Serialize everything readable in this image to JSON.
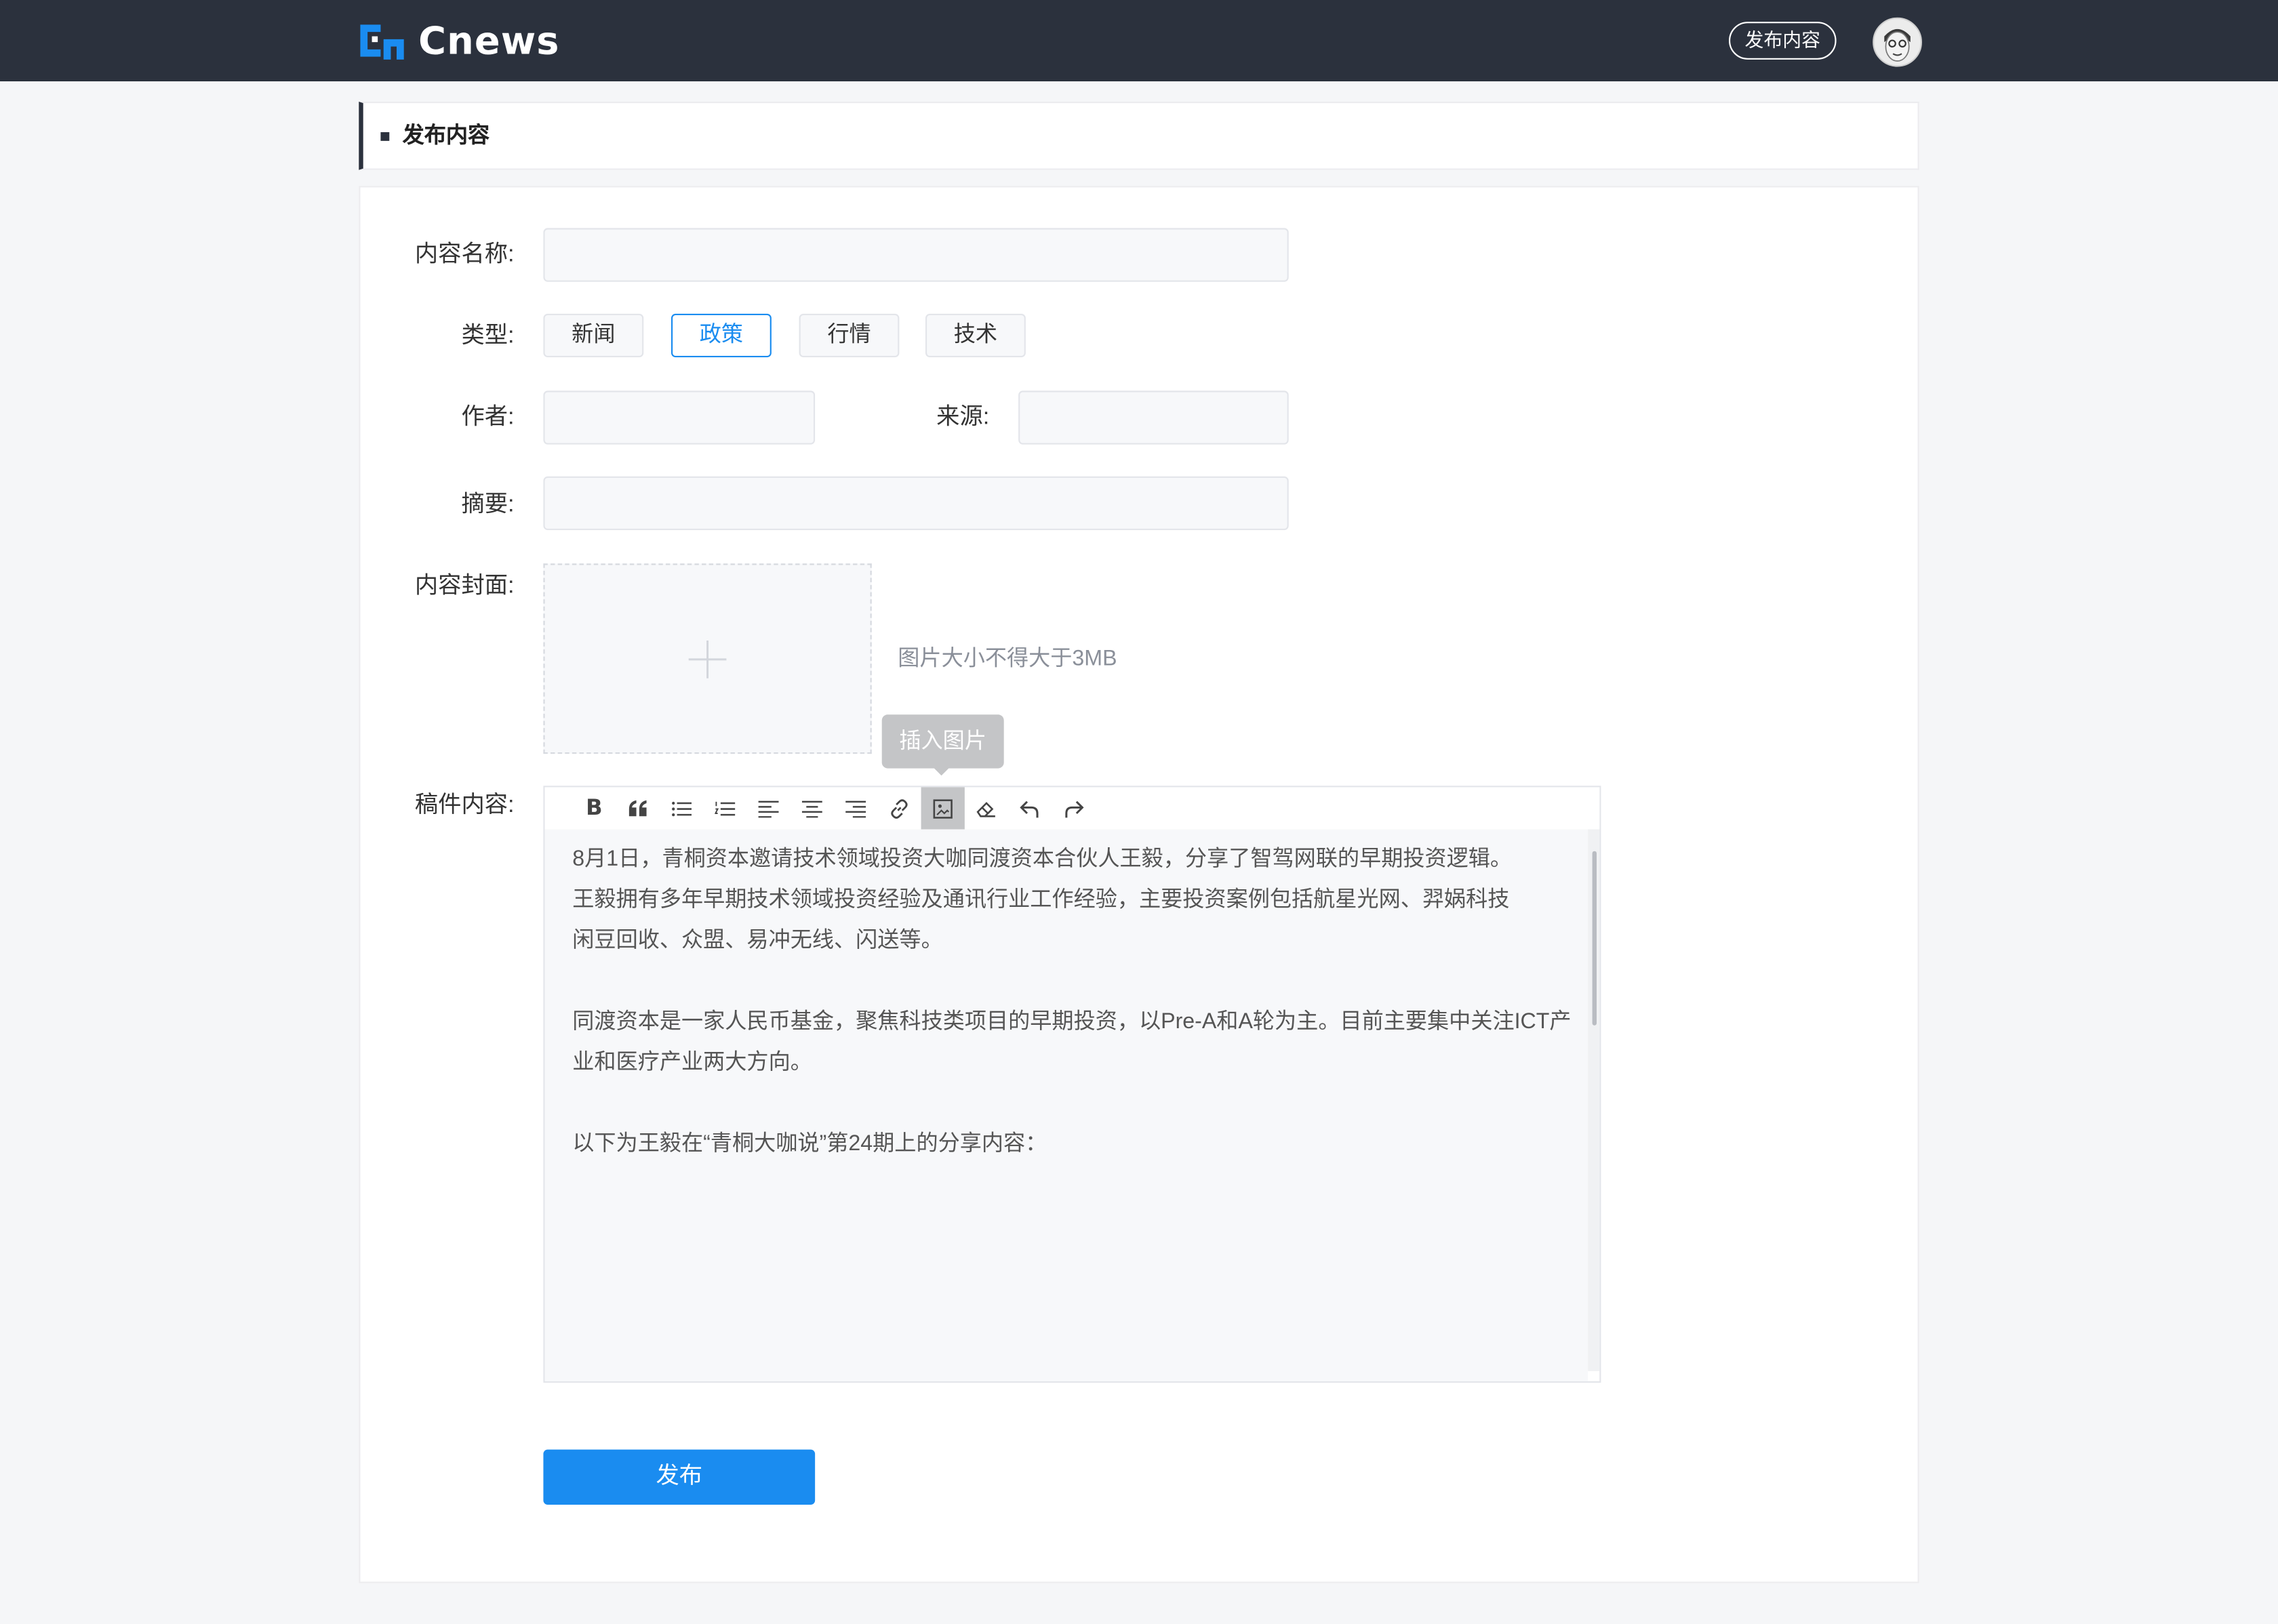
{
  "header": {
    "logo_text": "Cnews",
    "publish_link": "发布内容",
    "avatar_alt": ""
  },
  "page_title": "发布内容",
  "form": {
    "title_label": "内容名称:",
    "title_value": "",
    "type_label": "类型:",
    "types": [
      "新闻",
      "政策",
      "行情",
      "技术"
    ],
    "selected_type": "政策",
    "author_label": "作者:",
    "author_value": "",
    "source_label": "来源:",
    "source_value": "",
    "summary_label": "摘要:",
    "summary_value": "",
    "cover_label": "内容封面:",
    "cover_hint": "图片大小不得大于3MB",
    "content_label": "稿件内容:"
  },
  "editor": {
    "tooltip": "插入图片",
    "toolbar": [
      "bold-icon",
      "quote-icon",
      "bullet-list-icon",
      "numbered-list-icon",
      "align-left-icon",
      "align-center-icon",
      "align-right-icon",
      "link-icon",
      "image-icon",
      "eraser-icon",
      "undo-icon",
      "redo-icon"
    ],
    "paragraphs": [
      "8月1日，青桐资本邀请技术领域投资大咖同渡资本合伙人王毅，分享了智驾网联的早期投资逻辑。",
      "王毅拥有多年早期技术领域投资经验及通讯行业工作经验，主要投资案例包括航星光网、羿娲科技",
      "闲豆回收、众盟、易冲无线、闪送等。",
      "同渡资本是一家人民币基金，聚焦科技类项目的早期投资，以Pre-A和A轮为主。目前主要集中关注ICT产",
      "业和医疗产业两大方向。",
      "以下为王毅在“青桐大咖说”第24期上的分享内容："
    ]
  },
  "submit_label": "发布",
  "colors": {
    "header_bg": "#2b313d",
    "accent": "#1a8cf0",
    "logo_blue": "#1a8cf0"
  }
}
